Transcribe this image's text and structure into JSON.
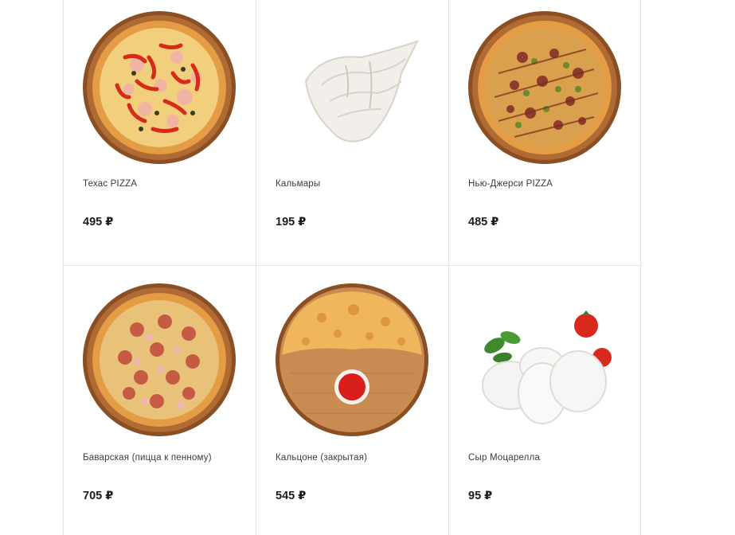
{
  "products": [
    {
      "name": "Техас PIZZA",
      "price": "495 ₽",
      "image_icon": "pizza-icon"
    },
    {
      "name": "Кальмары",
      "price": "195 ₽",
      "image_icon": "squid-icon"
    },
    {
      "name": "Нью-Джерси PIZZA",
      "price": "485 ₽",
      "image_icon": "pizza-icon"
    },
    {
      "name": "Баварская (пицца к пенному)",
      "price": "705 ₽",
      "image_icon": "pizza-icon"
    },
    {
      "name": "Кальцоне (закрытая)",
      "price": "545 ₽",
      "image_icon": "calzone-icon"
    },
    {
      "name": "Сыр Моцарелла",
      "price": "95 ₽",
      "image_icon": "mozzarella-icon"
    }
  ],
  "colors": {
    "board": "#a0622c",
    "crust": "#e8a54a",
    "cheese": "#f3d27a",
    "pepper": "#e0301e",
    "sausage": "#b8423a",
    "border": "#e6e6e6"
  }
}
